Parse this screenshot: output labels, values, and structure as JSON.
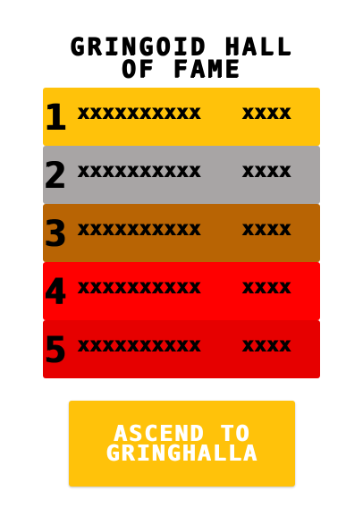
{
  "title": {
    "line1": "GRINGOID HALL",
    "line2": "OF FAME"
  },
  "leaderboard": [
    {
      "rank": "1",
      "name": "xxxxxxxxxx",
      "score": "xxxx",
      "color": "#ffc20a"
    },
    {
      "rank": "2",
      "name": "xxxxxxxxxx",
      "score": "xxxx",
      "color": "#a8a5a5"
    },
    {
      "rank": "3",
      "name": "xxxxxxxxxx",
      "score": "xxxx",
      "color": "#b86404"
    },
    {
      "rank": "4",
      "name": "xxxxxxxxxx",
      "score": "xxxx",
      "color": "#ff0000"
    },
    {
      "rank": "5",
      "name": "xxxxxxxxxx",
      "score": "xxxx",
      "color": "#e60000"
    }
  ],
  "ascend_button": {
    "line1": "ASCEND TO",
    "line2": "GRINGHALLA",
    "color": "#ffc20a"
  }
}
